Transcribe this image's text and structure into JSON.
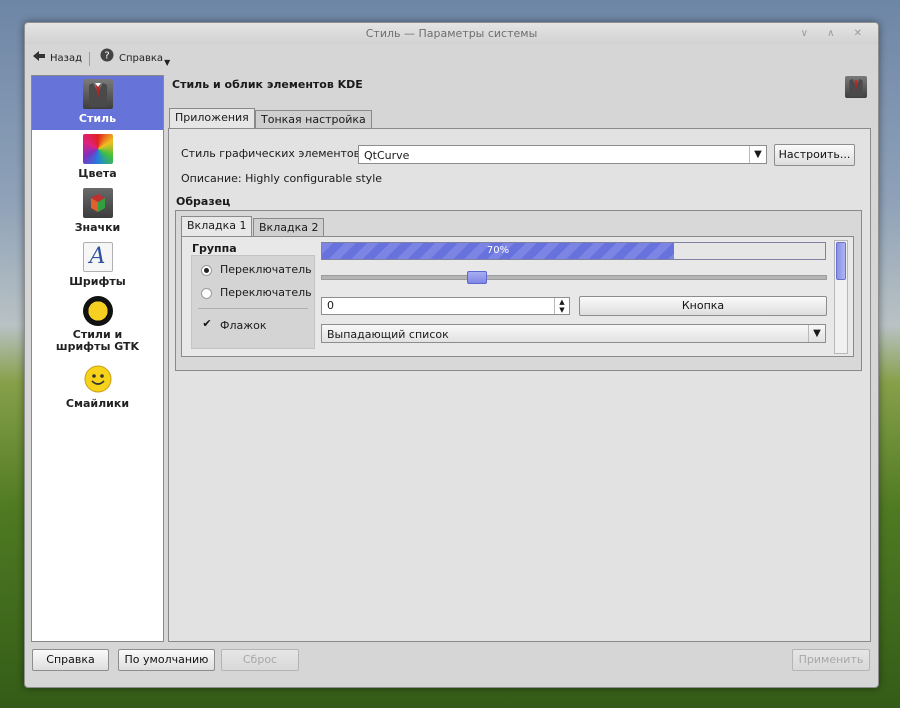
{
  "window": {
    "title": "Стиль — Параметры системы",
    "controls": "∨ ∧ ✕"
  },
  "toolbar": {
    "back_label": "Назад",
    "help_label": "Справка"
  },
  "sidebar": {
    "items": [
      {
        "label": "Стиль",
        "icon": "suit-icon"
      },
      {
        "label": "Цвета",
        "icon": "colors-icon"
      },
      {
        "label": "Значки",
        "icon": "icons-icon"
      },
      {
        "label": "Шрифты",
        "icon": "fonts-icon"
      },
      {
        "label": "Стили и шрифты GTK",
        "icon": "gtk-icon"
      },
      {
        "label": "Смайлики",
        "icon": "smiley-icon"
      }
    ]
  },
  "content": {
    "heading": "Стиль и облик элементов KDE",
    "tabs": [
      "Приложения",
      "Тонкая настройка"
    ],
    "widget_style_label": "Стиль графических элементов:",
    "widget_style_value": "QtCurve",
    "configure_label": "Настроить...",
    "description": "Описание: Highly configurable style",
    "preview_label": "Образец",
    "preview": {
      "tabs": [
        "Вкладка 1",
        "Вкладка 2"
      ],
      "group_label": "Группа",
      "radio1": "Переключатель",
      "radio2": "Переключатель",
      "checkbox": "Флажок",
      "progress_text": "70%",
      "progress_value": 0.7,
      "slider_value": 0.3,
      "spin_value": "0",
      "button_label": "Кнопка",
      "combo_label": "Выпадающий список"
    }
  },
  "footer": {
    "help": "Справка",
    "defaults": "По умолчанию",
    "reset": "Сброс",
    "apply": "Применить"
  },
  "colors": {
    "accent": "#6673d8",
    "window": "#d6d6d6"
  }
}
